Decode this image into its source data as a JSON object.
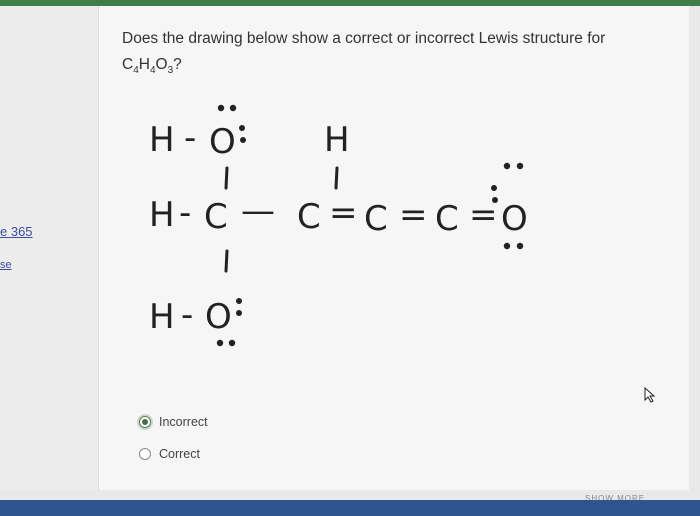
{
  "question": {
    "text": "Does the drawing below show a correct or incorrect Lewis structure for",
    "formula_c": "C",
    "formula_c_sub": "4",
    "formula_h": "H",
    "formula_h_sub": "4",
    "formula_o": "O",
    "formula_o_sub": "3",
    "formula_end": "?"
  },
  "gutter": {
    "link1": "e 365",
    "link2": "se"
  },
  "drawing": {
    "row1_h_left": "H",
    "row1_bond": "-",
    "row1_o": "O",
    "row1_h_right": "H",
    "row2_h": "H",
    "row2_bond1": "-",
    "row2_c1": "C",
    "row2_bond2": "—",
    "row2_c2": "C",
    "row2_bond3": "=",
    "row2_c3": "C",
    "row2_bond4": "=",
    "row2_c4": "C",
    "row2_bond5": "=",
    "row2_o": "O",
    "row3_h": "H",
    "row3_bond": "-",
    "row3_o": "O"
  },
  "options": [
    {
      "label": "Incorrect",
      "selected": true
    },
    {
      "label": "Correct",
      "selected": false
    }
  ],
  "footer": {
    "show_more": "SHOW MORE"
  }
}
